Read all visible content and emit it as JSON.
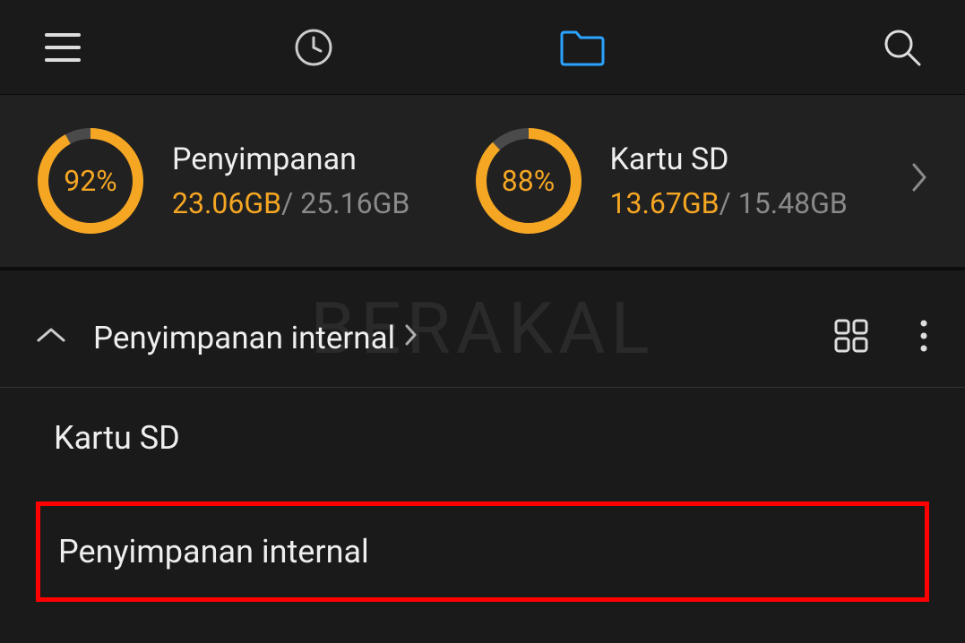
{
  "watermark": "BERAKAL",
  "storage": [
    {
      "title": "Penyimpanan",
      "percent_label": "92%",
      "percent": 92,
      "used": "23.06GB",
      "total": "25.16GB"
    },
    {
      "title": "Kartu SD",
      "percent_label": "88%",
      "percent": 88,
      "used": "13.67GB",
      "total": "15.48GB"
    }
  ],
  "breadcrumb": {
    "label": "Penyimpanan internal"
  },
  "options": [
    {
      "label": "Kartu SD"
    },
    {
      "label": "Penyimpanan internal"
    }
  ],
  "colors": {
    "accent": "#f5a623",
    "ring_bg": "#4a4a4a",
    "folder_active": "#1e90ff"
  }
}
